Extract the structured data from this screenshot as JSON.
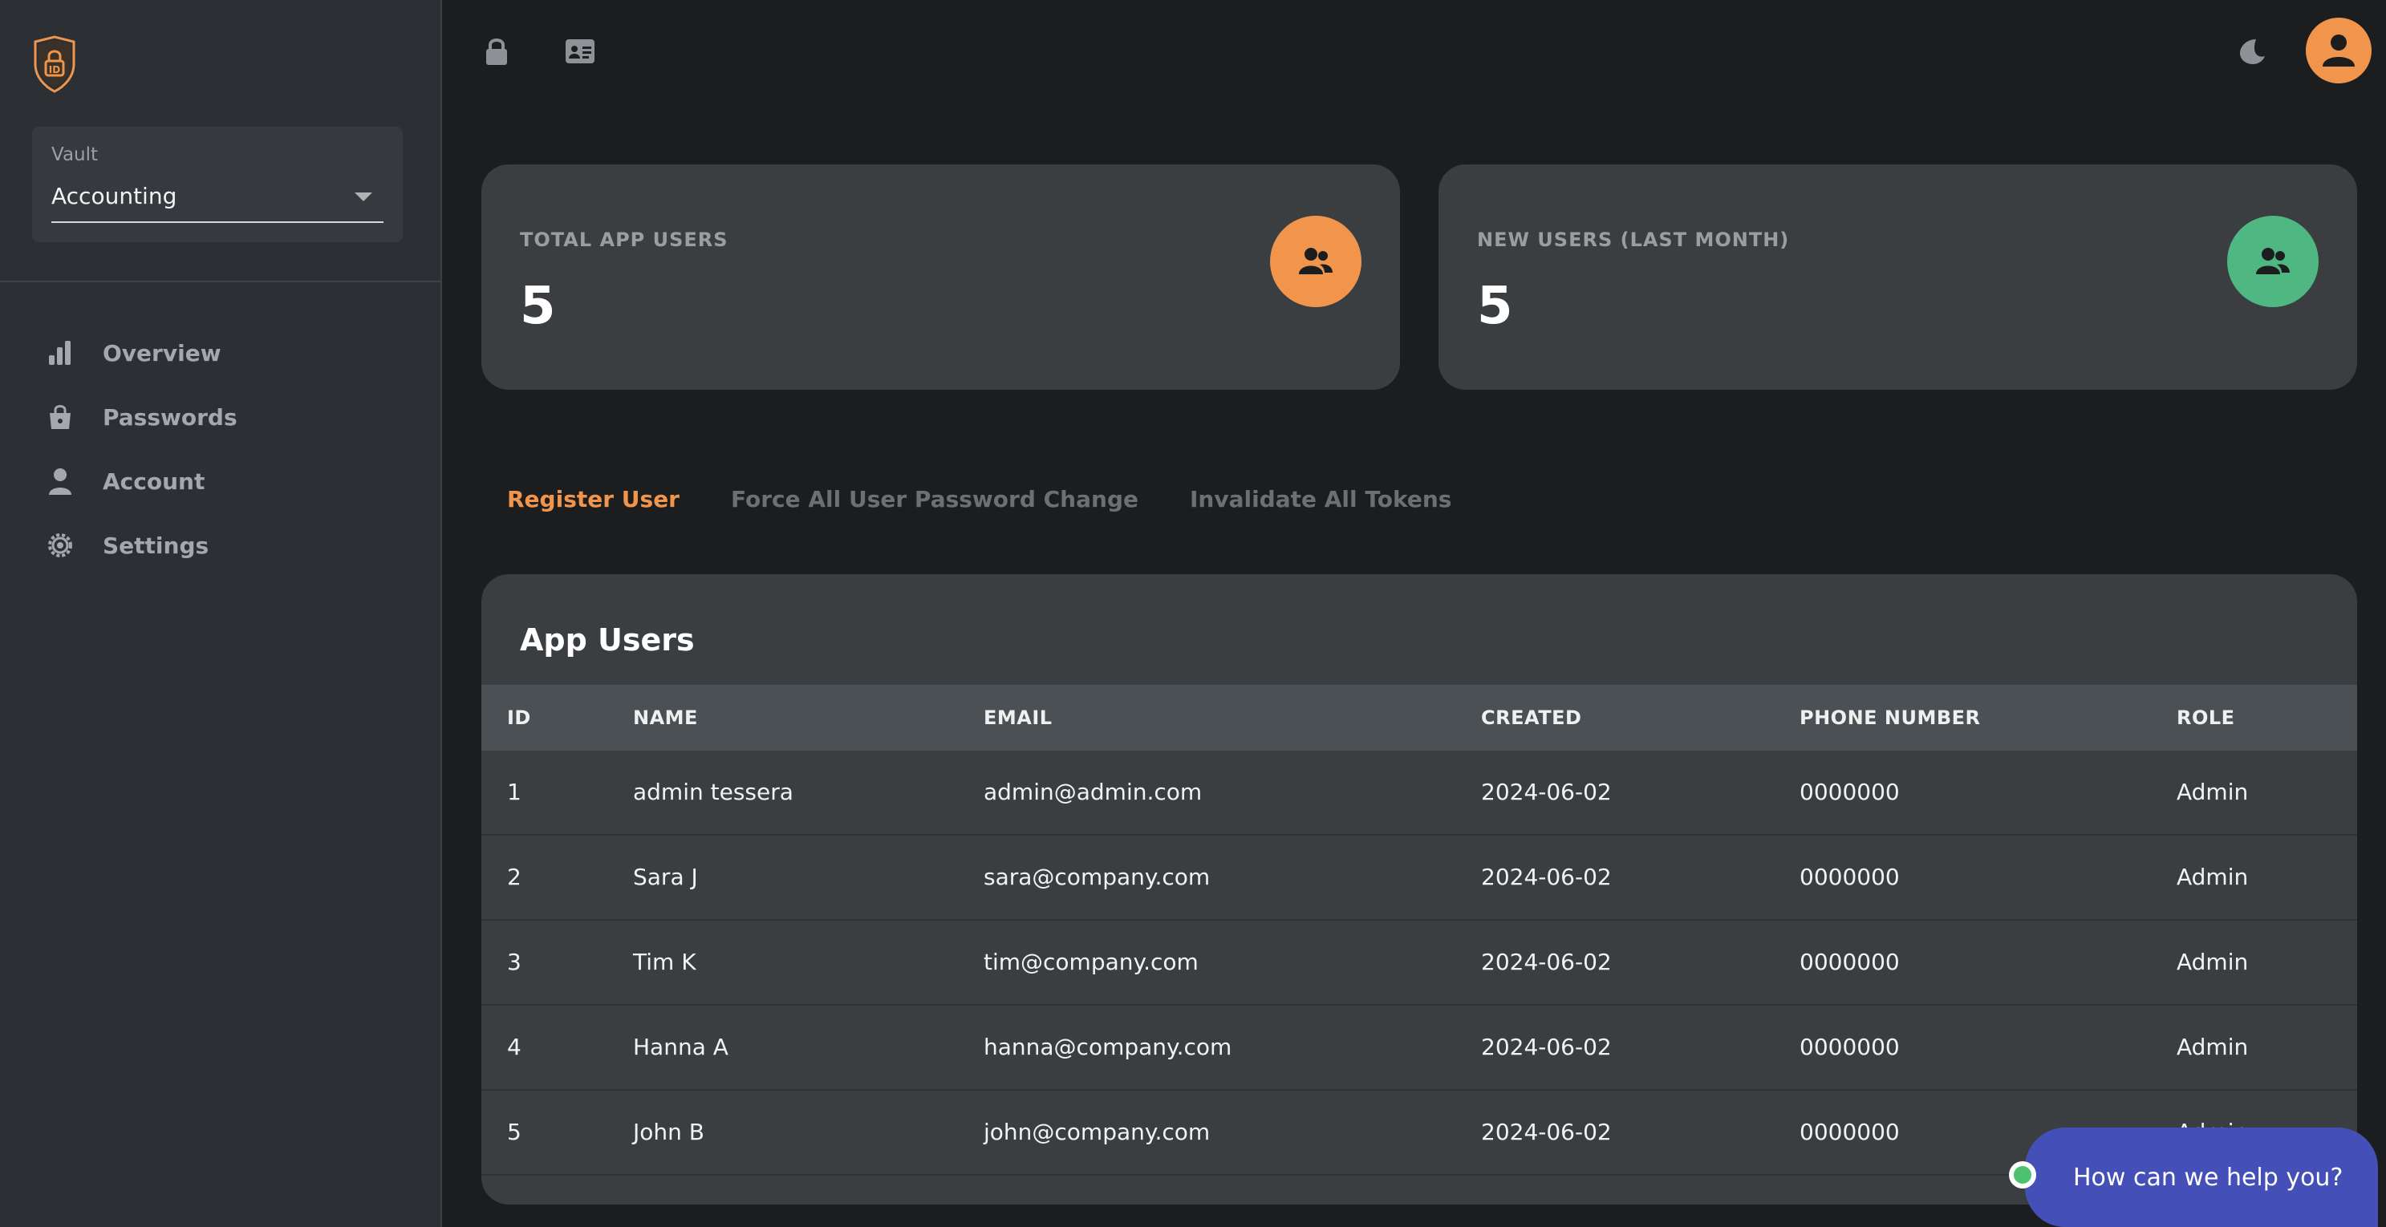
{
  "sidebar": {
    "vault": {
      "label": "Vault",
      "value": "Accounting"
    },
    "nav": [
      {
        "label": "Overview",
        "icon": "bar-chart-icon"
      },
      {
        "label": "Passwords",
        "icon": "shopping-bag-icon"
      },
      {
        "label": "Account",
        "icon": "person-icon"
      },
      {
        "label": "Settings",
        "icon": "gear-icon"
      }
    ]
  },
  "stats": [
    {
      "label": "TOTAL APP USERS",
      "value": "5",
      "badge_color": "#f0954b",
      "icon": "users-icon"
    },
    {
      "label": "NEW USERS (LAST MONTH)",
      "value": "5",
      "badge_color": "#4fb882",
      "icon": "users-icon"
    }
  ],
  "actions": [
    {
      "label": "Register User",
      "active": true
    },
    {
      "label": "Force All User Password Change",
      "active": false
    },
    {
      "label": "Invalidate All Tokens",
      "active": false
    }
  ],
  "table": {
    "title": "App Users",
    "columns": [
      "ID",
      "NAME",
      "EMAIL",
      "CREATED",
      "PHONE NUMBER",
      "ROLE"
    ],
    "rows": [
      [
        "1",
        "admin tessera",
        "admin@admin.com",
        "2024-06-02",
        "0000000",
        "Admin"
      ],
      [
        "2",
        "Sara J",
        "sara@company.com",
        "2024-06-02",
        "0000000",
        "Admin"
      ],
      [
        "3",
        "Tim K",
        "tim@company.com",
        "2024-06-02",
        "0000000",
        "Admin"
      ],
      [
        "4",
        "Hanna A",
        "hanna@company.com",
        "2024-06-02",
        "0000000",
        "Admin"
      ],
      [
        "5",
        "John B",
        "john@company.com",
        "2024-06-02",
        "0000000",
        "Admin"
      ]
    ]
  },
  "chat": {
    "text": "How can we help you?"
  },
  "colors": {
    "accent": "#f0954b",
    "success": "#4fb882",
    "chat": "#4450b8"
  }
}
